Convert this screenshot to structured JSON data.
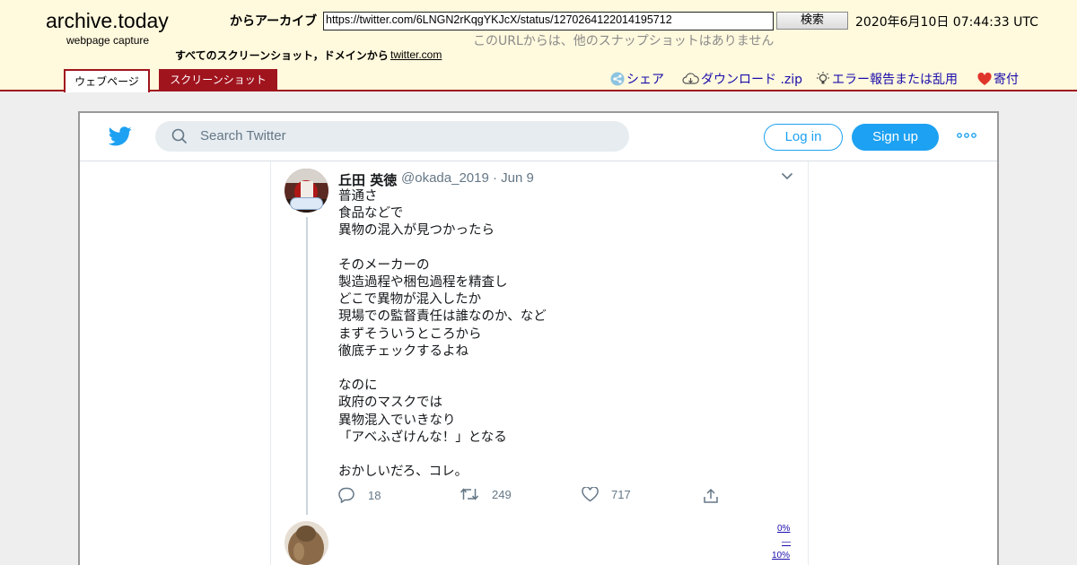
{
  "archive": {
    "logo": "archive.today",
    "subtitle": "webpage capture",
    "from_archive_label": "からアーカイブ",
    "url": "https://twitter.com/6LNGN2rKqgYKJcX/status/1270264122014195712",
    "search_button": "検索",
    "capture_date": "2020年6月10日 07:44:33 UTC",
    "no_snapshots": "このURLからは、他のスナップショットはありません",
    "all_screenshots_label": "すべてのスクリーンショット，ドメインから",
    "domain_link": "twitter.com",
    "tabs": [
      {
        "label": "ウェブページ",
        "active": true
      },
      {
        "label": "スクリーンショット",
        "active": false
      }
    ],
    "actions": {
      "share": "シェア",
      "download": "ダウンロード .zip",
      "report": "エラー報告または乱用",
      "donate": "寄付"
    },
    "colors": {
      "header_bg": "#fff9dd",
      "accent": "#a0141e",
      "link": "#1a0dab"
    }
  },
  "twitter": {
    "search_placeholder": "Search Twitter",
    "login": "Log in",
    "signup": "Sign up",
    "colors": {
      "brand": "#1da1f2"
    },
    "tweet": {
      "name": "丘田 英徳",
      "handle": "@okada_2019 · Jun 9",
      "text": "普通さ\n食品などで\n異物の混入が見つかったら\n\nそのメーカーの\n製造過程や梱包過程を精査し\nどこで異物が混入したか\n現場での監督責任は誰なのか、など\nまずそういうところから\n徹底チェックするよね\n\nなのに\n政府のマスクでは\n異物混入でいきなり\n「アベふざけんな！」となる\n\nおかしいだろ、コレ。",
      "replies": "18",
      "retweets": "249",
      "likes": "717"
    },
    "scroll_markers": [
      "0%",
      "—",
      "10%"
    ]
  }
}
